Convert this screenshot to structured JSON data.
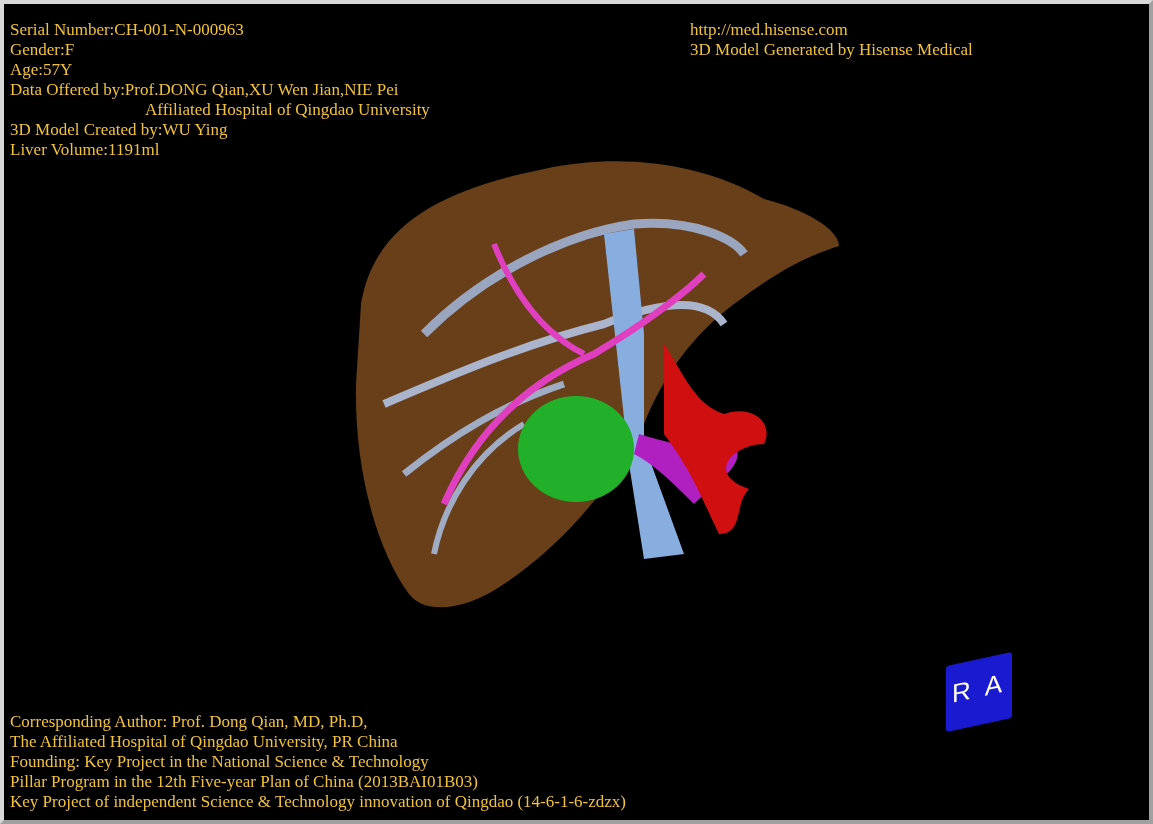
{
  "header": {
    "info_lines": [
      {
        "text": "Serial Number:CH-001-N-000963",
        "kind": "field"
      },
      {
        "text": "Gender:F",
        "kind": "field"
      },
      {
        "text": "Age:57Y",
        "kind": "field"
      },
      {
        "text": "Data Offered by:Prof.DONG Qian,XU Wen Jian,NIE Pei",
        "kind": "field"
      },
      {
        "text": "Affiliated Hospital of Qingdao University",
        "kind": "continuation"
      },
      {
        "text": "3D Model Created by:WU Ying",
        "kind": "field"
      },
      {
        "text": "Liver Volume:1191ml",
        "kind": "field"
      }
    ],
    "brand_lines": [
      "http://med.hisense.com",
      "3D Model Generated by Hisense Medical"
    ]
  },
  "orientation_cube": {
    "faces": [
      "R",
      "A"
    ]
  },
  "credits": [
    "Corresponding Author: Prof. Dong Qian, MD, Ph.D,",
    "The Affiliated Hospital of Qingdao University, PR China",
    "Founding: Key Project in the National Science & Technology",
    "Pillar Program in the 12th Five-year Plan of China (2013BAI01B03)",
    "Key Project of independent Science & Technology innovation of Qingdao (14-6-1-6-zdzx)"
  ]
}
